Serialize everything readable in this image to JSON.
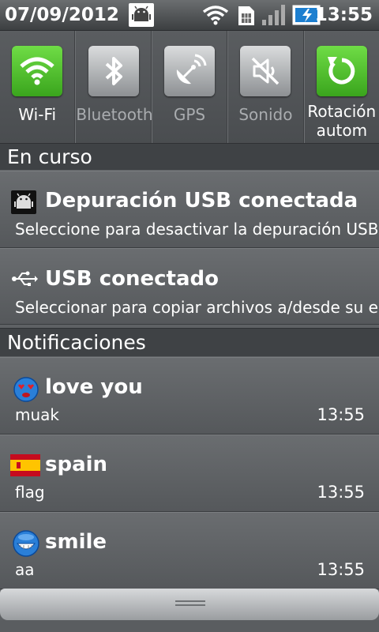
{
  "status_bar": {
    "date": "07/09/2012",
    "time": "13:55",
    "icons": [
      "android-debug-icon",
      "wifi-icon",
      "sim-icon",
      "signal-icon",
      "battery-charging-icon"
    ]
  },
  "quick_settings": [
    {
      "label": "Wi-Fi",
      "state": "on",
      "icon": "wifi-icon"
    },
    {
      "label": "Bluetooth",
      "state": "off",
      "icon": "bluetooth-icon"
    },
    {
      "label": "GPS",
      "state": "off",
      "icon": "gps-icon"
    },
    {
      "label": "Sonido",
      "state": "off",
      "icon": "sound-muted-icon"
    },
    {
      "label": "Rotación\nautom",
      "state": "on",
      "icon": "rotation-icon"
    }
  ],
  "ongoing": {
    "header": "En curso",
    "items": [
      {
        "title": "Depuración USB conectada",
        "subtitle": "Seleccione para desactivar la depuración USB.",
        "icon": "android-debug-icon"
      },
      {
        "title": "USB conectado",
        "subtitle": "Seleccionar para copiar archivos a/desde su equip",
        "icon": "usb-icon"
      }
    ]
  },
  "notifications": {
    "header": "Notificaciones",
    "items": [
      {
        "title": "love you",
        "subtitle": "muak",
        "time": "13:55",
        "icon": "love-emoticon-icon"
      },
      {
        "title": "spain",
        "subtitle": "flag",
        "time": "13:55",
        "icon": "spain-flag-icon"
      },
      {
        "title": "smile",
        "subtitle": "aa",
        "time": "13:55",
        "icon": "smile-emoticon-icon"
      }
    ]
  },
  "colors": {
    "toggle_on": "#3aa51d",
    "toggle_off": "#8d9093",
    "header_bg": "#3f4245"
  }
}
